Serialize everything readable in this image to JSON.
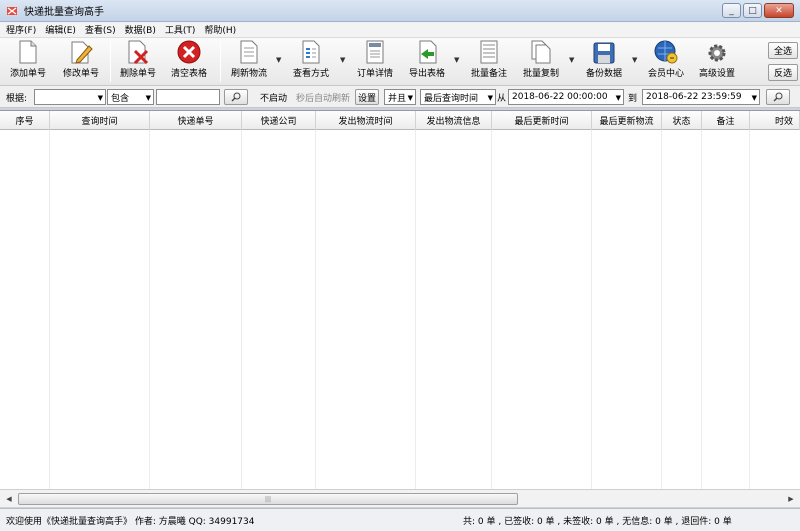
{
  "window": {
    "title": "快递批量查询高手",
    "close": "✕",
    "maximize": "□",
    "minimize": "_"
  },
  "menu": [
    "程序(F)",
    "编辑(E)",
    "查看(S)",
    "数据(B)",
    "工具(T)",
    "帮助(H)"
  ],
  "toolbar": {
    "add": "添加单号",
    "edit": "修改单号",
    "delete": "删除单号",
    "clear": "清空表格",
    "refresh": "刷新物流",
    "viewmode": "查看方式",
    "detail": "订单详情",
    "export": "导出表格",
    "batchnote": "批量备注",
    "batchcopy": "批量复制",
    "backup": "备份数据",
    "member": "会员中心",
    "advanced": "高级设置",
    "select_all": "全选",
    "invert": "反选"
  },
  "filter": {
    "by_label": "根据:",
    "field_value": "",
    "match_value": "包含",
    "keyword": "",
    "auto_start": "不启动",
    "auto_refresh_hint": "秒后自动刷新",
    "settings": "设置",
    "logic_value": "并且",
    "time_field": "最后查询时间",
    "from_label": "从",
    "date_from": "2018-06-22 00:00:00",
    "to_label": "到",
    "date_to": "2018-06-22 23:59:59"
  },
  "columns": [
    "序号",
    "查询时间",
    "快递单号",
    "快递公司",
    "发出物流时间",
    "发出物流信息",
    "最后更新时间",
    "最后更新物流",
    "状态",
    "备注",
    "时效"
  ],
  "status": {
    "welcome": "欢迎使用《快递批量查询高手》 作者: 方晨曦  QQ: 34991734",
    "counts": "共: 0 单 , 已签收: 0 单 , 未签收: 0 单 , 无信息: 0 单 , 退回件: 0 单"
  },
  "colors": {
    "accent": "#1f5fbf",
    "delete_red": "#d32020",
    "window_bg": "#c8d3e3"
  }
}
